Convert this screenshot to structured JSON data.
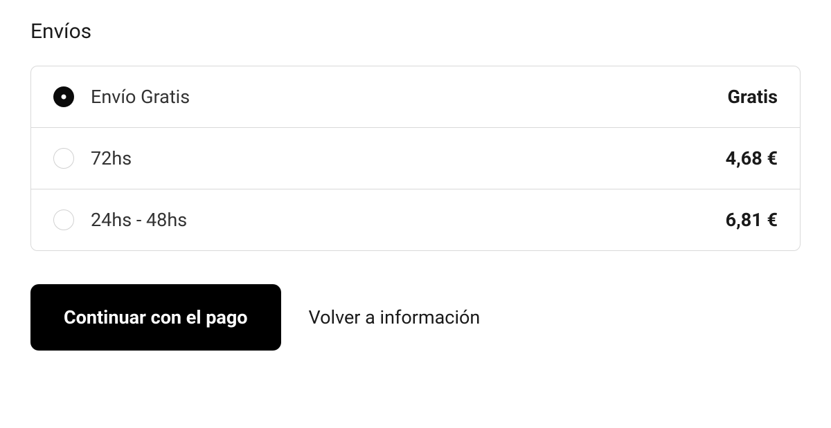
{
  "section": {
    "title": "Envíos"
  },
  "shipping": {
    "options": [
      {
        "label": "Envío Gratis",
        "price": "Gratis",
        "selected": true
      },
      {
        "label": "72hs",
        "price": "4,68 €",
        "selected": false
      },
      {
        "label": "24hs - 48hs",
        "price": "6,81 €",
        "selected": false
      }
    ]
  },
  "actions": {
    "continue": "Continuar con el pago",
    "back": "Volver a información"
  }
}
